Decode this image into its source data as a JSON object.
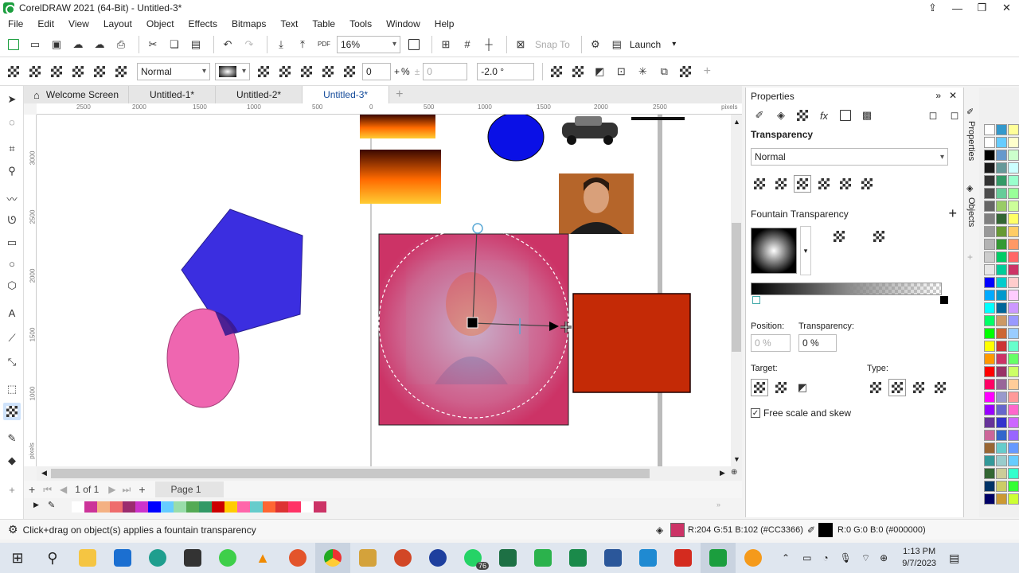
{
  "window": {
    "title": "CorelDRAW 2021 (64-Bit) - Untitled-3*"
  },
  "menu": [
    "File",
    "Edit",
    "View",
    "Layout",
    "Object",
    "Effects",
    "Bitmaps",
    "Text",
    "Table",
    "Tools",
    "Window",
    "Help"
  ],
  "toolbar1": {
    "zoom": "16%",
    "snap_to": "Snap To",
    "launch": "Launch"
  },
  "toolbar2": {
    "mode": "Normal",
    "transparency_value": "0",
    "percent": "%",
    "midpoint_value": "0",
    "angle": "-2.0 °"
  },
  "tabs": [
    {
      "label": "Welcome Screen",
      "icon": "home-icon"
    },
    {
      "label": "Untitled-1*"
    },
    {
      "label": "Untitled-2*"
    },
    {
      "label": "Untitled-3*",
      "active": true
    }
  ],
  "ruler": {
    "h_ticks": [
      "2500",
      "2000",
      "1500",
      "1000",
      "500",
      "0",
      "500",
      "1000",
      "1500",
      "2000",
      "2500"
    ],
    "h_unit": "pixels",
    "v_ticks": [
      "3000",
      "2500",
      "2000",
      "1500",
      "1000"
    ],
    "v_unit": "pixels"
  },
  "pagebar": {
    "page_of": "1 of 1",
    "page_tab": "Page 1"
  },
  "status": {
    "hint": "Click+drag on object(s) applies a fountain transparency",
    "fill": "R:204 G:51 B:102 (#CC3366)",
    "outline": "R:0 G:0 B:0 (#000000)",
    "fill_color": "#CC3366",
    "outline_color": "#000000"
  },
  "properties": {
    "header": "Properties",
    "section": "Transparency",
    "merge_mode": "Normal",
    "fountain_label": "Fountain Transparency",
    "position_label": "Position:",
    "position_value": "0 %",
    "transparency_label": "Transparency:",
    "transparency_value": "0 %",
    "target_label": "Target:",
    "type_label": "Type:",
    "free_scale": "Free scale and skew"
  },
  "sidetabs": [
    "Properties",
    "Objects"
  ],
  "taskbar": {
    "time": "1:13 PM",
    "date": "9/7/2023",
    "badge": "76"
  },
  "colors": {
    "pink": "#CC3366",
    "blue_pentagon": "#3b2ee0",
    "ellipse": "#ef66b0",
    "red_rect": "#c42a06",
    "circle": "#0a10e6"
  },
  "doc_palette": [
    "#ffffff",
    "#cc3399",
    "#f4b183",
    "#ee6c6c",
    "#9b2c6e",
    "#cc33cc",
    "#0000ff",
    "#66ccff",
    "#99ddaa",
    "#55aa55",
    "#339966",
    "#cc0000",
    "#ffcc00",
    "#ff66aa",
    "#66cccc",
    "#ff6633",
    "#dd3333",
    "#ff3366",
    "#ffffff",
    "#cc3366"
  ]
}
